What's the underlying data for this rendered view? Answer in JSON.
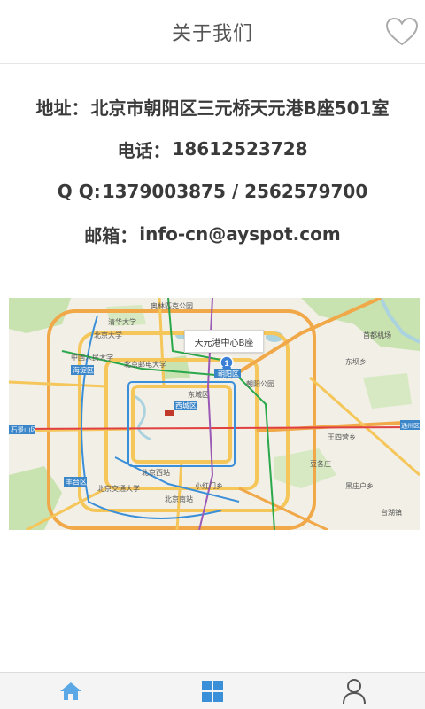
{
  "header": {
    "title": "关于我们",
    "favorite_icon": "heart-outline-icon"
  },
  "contact": {
    "address_label": "地址：",
    "address_value": "北京市朝阳区三元桥天元港B座501室",
    "phone_label": "电话：",
    "phone_value": "18612523728",
    "qq_label": "Q Q: ",
    "qq_value": "1379003875 / 2562579700",
    "email_label": "邮箱：",
    "email_value": "info-cn@ayspot.com"
  },
  "map": {
    "marker_label": "天元港中心B座",
    "labels": [
      "清华大学",
      "北京大学",
      "中国人民大学",
      "北京邮电大学",
      "海淀区",
      "北京交通大学",
      "西城区",
      "东城区",
      "朝阳区",
      "朝阳公园",
      "北京西站",
      "北京南站",
      "石景山区",
      "丰台区",
      "东坝乡",
      "豆各庄",
      "通州区",
      "首都机场",
      "奥林匹克公园",
      "小红门乡",
      "王四营乡",
      "台湖镇",
      "黑庄户乡"
    ],
    "colors": {
      "land": "#f2efe6",
      "green": "#c8e2b0",
      "water": "#aad3df",
      "ring_road": "#f5c65a",
      "highway": "#f0a848",
      "metro_blue": "#3b8fd8",
      "metro_green": "#2aa84b",
      "metro_red": "#e04040",
      "metro_purple": "#9b59b6",
      "district_label": "#3b86c9"
    }
  },
  "tabbar": {
    "tabs": [
      {
        "name": "home",
        "icon": "home-icon",
        "color": "#5aa9e6"
      },
      {
        "name": "grid",
        "icon": "grid-icon",
        "color": "#3a8fd9"
      },
      {
        "name": "profile",
        "icon": "user-icon",
        "color": "#555555"
      }
    ]
  }
}
